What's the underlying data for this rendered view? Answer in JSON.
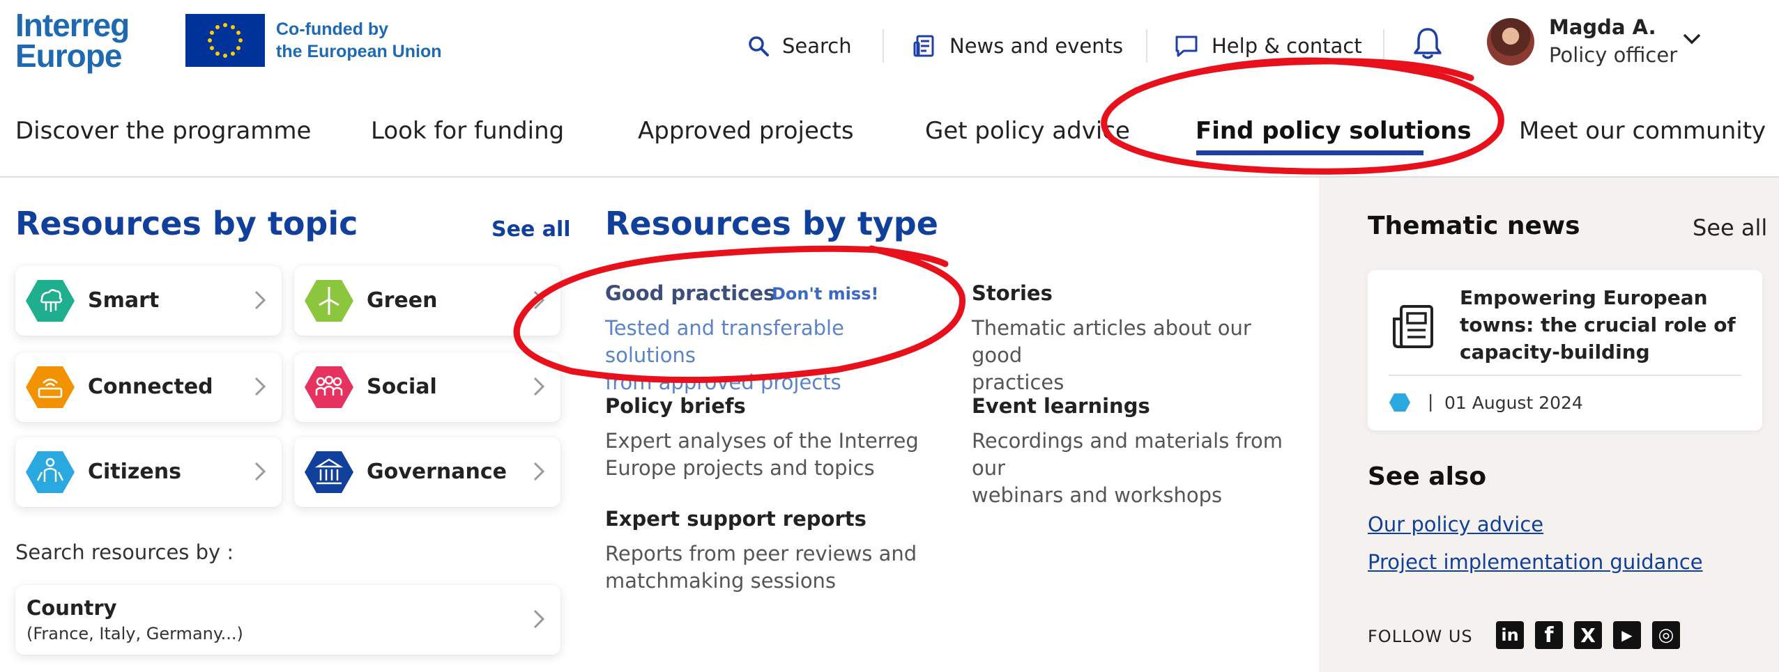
{
  "brand": {
    "logo_line1": "Interreg",
    "logo_line2": "Europe",
    "eu_line1": "Co-funded by",
    "eu_line2": "the European Union",
    "color": "#1d6ab3"
  },
  "top_nav": {
    "search": "Search",
    "news": "News and events",
    "help": "Help & contact",
    "icons": [
      "search-icon",
      "news-icon",
      "chat-icon",
      "bell-icon"
    ]
  },
  "user": {
    "name": "Magda A.",
    "role": "Policy officer"
  },
  "main_nav": {
    "items": [
      "Discover the programme",
      "Look for funding",
      "Approved projects",
      "Get policy advice",
      "Find policy solutions",
      "Meet our community"
    ],
    "active": "Find policy solutions",
    "accent": "#1d3fa6"
  },
  "topics": {
    "heading": "Resources by topic",
    "see_all": "See all",
    "items": [
      {
        "label": "Smart",
        "color": "#1fae8e",
        "icon": "cloud-network-icon"
      },
      {
        "label": "Green",
        "color": "#8cc63f",
        "icon": "wind-turbine-icon"
      },
      {
        "label": "Connected",
        "color": "#f39200",
        "icon": "router-icon"
      },
      {
        "label": "Social",
        "color": "#e5325f",
        "icon": "people-icon"
      },
      {
        "label": "Citizens",
        "color": "#2aa8e0",
        "icon": "citizens-icon"
      },
      {
        "label": "Governance",
        "color": "#103f9c",
        "icon": "building-icon"
      }
    ]
  },
  "search_by": {
    "label": "Search resources by :",
    "country_title": "Country",
    "country_sub": "(France, Italy, Germany...)"
  },
  "types": {
    "heading": "Resources by type",
    "good_practices_title": "Good practices",
    "dont_miss": "Don't miss!",
    "good_practices_desc1": "Tested and transferable solutions",
    "good_practices_desc2": "from approved projects",
    "stories_title": "Stories",
    "stories_desc1": "Thematic articles about our good",
    "stories_desc2": "practices",
    "policy_briefs_title": "Policy briefs",
    "policy_briefs_desc1": "Expert analyses of the Interreg",
    "policy_briefs_desc2": "Europe projects and topics",
    "event_learnings_title": "Event learnings",
    "event_learnings_desc1": "Recordings and materials from our",
    "event_learnings_desc2": "webinars and workshops",
    "expert_reports_title": "Expert support reports",
    "expert_reports_desc1": "Reports from peer reviews and",
    "expert_reports_desc2": "matchmaking sessions"
  },
  "thematic_news": {
    "heading": "Thematic news",
    "see_all": "See all",
    "card_title": "Empowering European towns: the crucial role of capacity-building",
    "card_date": "01 August 2024",
    "card_icon": "newspaper-icon",
    "tag_color": "#2aa8e0"
  },
  "see_also": {
    "heading": "See also",
    "links": [
      "Our policy advice",
      "Project implementation guidance"
    ]
  },
  "follow": {
    "label": "FOLLOW US",
    "networks": [
      "linkedin-icon",
      "facebook-icon",
      "x-icon",
      "youtube-icon",
      "instagram-icon"
    ],
    "linkedin_text": "in",
    "facebook_text": "f",
    "x_text": "X",
    "youtube_text": "▶",
    "instagram_text": "◎"
  },
  "annotation_color": "#e8101a"
}
